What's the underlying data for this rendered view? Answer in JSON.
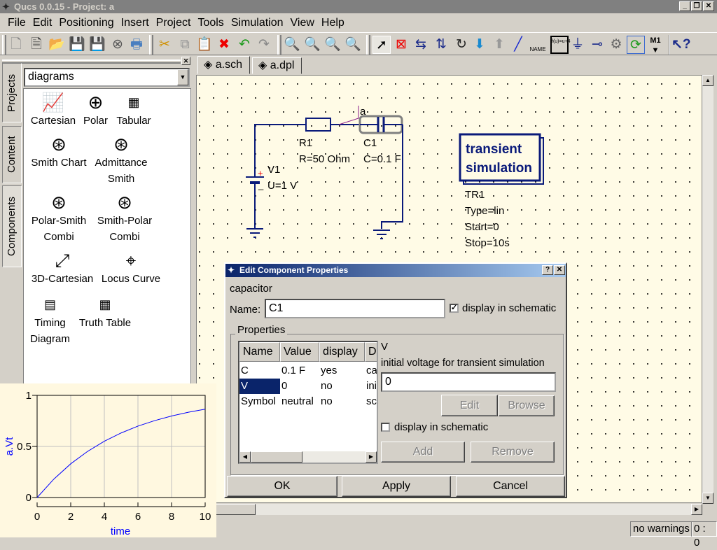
{
  "window": {
    "title": "Qucs 0.0.15 - Project: a",
    "buttons": [
      "_",
      "❐",
      "✕"
    ]
  },
  "menu": [
    "File",
    "Edit",
    "Positioning",
    "Insert",
    "Project",
    "Tools",
    "Simulation",
    "View",
    "Help"
  ],
  "toolbar": {
    "file": [
      "new-icon",
      "new-text-icon",
      "open-icon",
      "save-icon",
      "save-all-icon",
      "close-icon",
      "print-icon"
    ],
    "edit": [
      "cut-icon",
      "copy-icon",
      "paste-icon",
      "delete-icon",
      "undo-icon",
      "redo-icon"
    ],
    "view": [
      "zoom-fit-icon",
      "zoom-1-1-icon",
      "zoom-in-icon",
      "zoom-out-icon"
    ],
    "tools": [
      "select-icon",
      "deactivate-icon",
      "mirror-x-icon",
      "mirror-y-icon",
      "rotate-icon",
      "go-into-subcircuit-icon",
      "pop-out-icon",
      "wire-icon",
      "wire-label-icon",
      "equation-icon",
      "ground-icon",
      "port-icon",
      "simulate-icon",
      "view-data-icon",
      "marker-icon",
      "whats-this-icon"
    ],
    "labels": {
      "wire_label": "NAME",
      "equation": "f(u)=u+4",
      "marker": "M1"
    }
  },
  "dock": {
    "side_tabs": [
      "Projects",
      "Content",
      "Components"
    ],
    "category": "diagrams",
    "items": [
      {
        "label": "Cartesian"
      },
      {
        "label": "Polar"
      },
      {
        "label": "Tabular"
      },
      {
        "label": "Smith Chart"
      },
      {
        "label": "Admittance Smith"
      },
      {
        "label": "Polar-Smith Combi"
      },
      {
        "label": "Smith-Polar Combi"
      },
      {
        "label": "3D-Cartesian"
      },
      {
        "label": "Locus Curve"
      },
      {
        "label": "Timing Diagram"
      },
      {
        "label": "Truth Table"
      }
    ]
  },
  "doc_tabs": [
    "a.sch",
    "a.dpl"
  ],
  "schematic": {
    "node_label": "a",
    "r1": {
      "name": "R1",
      "value": "R=50 Ohm"
    },
    "c1": {
      "name": "C1",
      "value": "C=0.1 F"
    },
    "v1": {
      "name": "V1",
      "value": "U=1 V",
      "plus": "+",
      "minus": "_"
    },
    "sim": {
      "title1": "transient",
      "title2": "simulation",
      "name": "TR1",
      "type": "Type=lin",
      "start": "Start=0",
      "stop": "Stop=10s"
    }
  },
  "dialog": {
    "title": "Edit Component Properties",
    "help": "?",
    "close": "✕",
    "component": "capacitor",
    "name_label": "Name:",
    "name_value": "C1",
    "display_label": "display in schematic",
    "display_checked": true,
    "group": "Properties",
    "columns": [
      "Name",
      "Value",
      "display",
      "D"
    ],
    "rows": [
      {
        "name": "C",
        "value": "0.1 F",
        "display": "yes",
        "desc": "ca"
      },
      {
        "name": "V",
        "value": "0",
        "display": "no",
        "desc": "ini"
      },
      {
        "name": "Symbol",
        "value": "neutral",
        "display": "no",
        "desc": "sc"
      }
    ],
    "selected_prop": "V",
    "prop_desc": "initial voltage for transient simulation",
    "prop_value": "0",
    "edit": "Edit",
    "browse": "Browse",
    "prop_display_label": "display in schematic",
    "add": "Add",
    "remove": "Remove",
    "ok": "OK",
    "apply": "Apply",
    "cancel": "Cancel"
  },
  "status": {
    "warnings": "no warnings",
    "position": "0 : 0"
  },
  "chart_data": {
    "type": "line",
    "xlabel": "time",
    "ylabel": "a.Vt",
    "xlim": [
      0,
      10
    ],
    "ylim": [
      0,
      1
    ],
    "xticks": [
      "0",
      "2",
      "4",
      "6",
      "8",
      "10"
    ],
    "yticks": [
      "0",
      "0.5",
      "1"
    ],
    "grid": true,
    "series": [
      {
        "name": "a.Vt",
        "color": "#0000ff",
        "x": [
          0,
          1,
          2,
          3,
          4,
          5,
          6,
          7,
          8,
          9,
          10
        ],
        "y": [
          0,
          0.181,
          0.33,
          0.451,
          0.551,
          0.632,
          0.699,
          0.753,
          0.798,
          0.835,
          0.865
        ]
      }
    ]
  }
}
